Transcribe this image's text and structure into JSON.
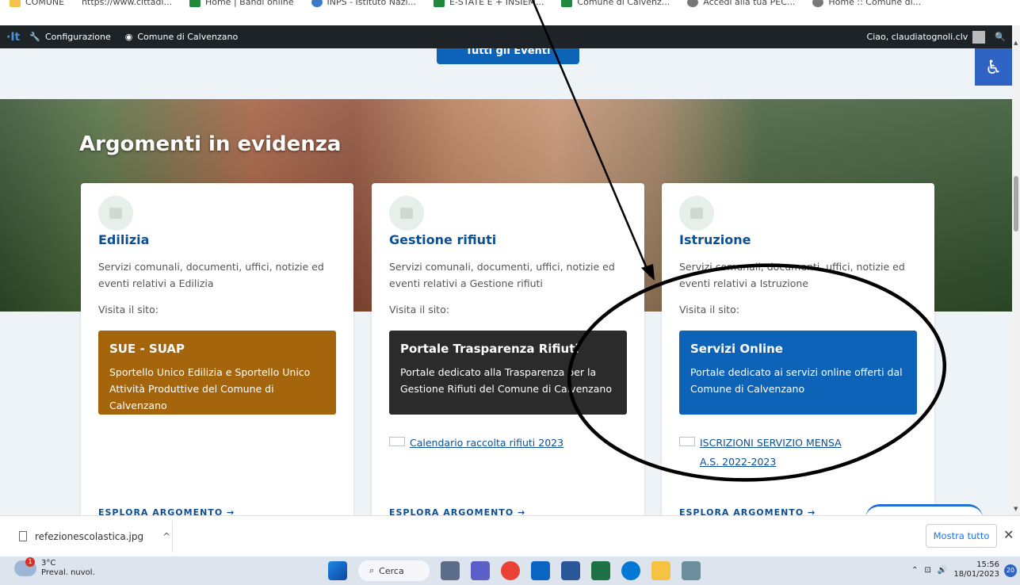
{
  "bookmarks": [
    {
      "label": "COMUNE",
      "icon": "folder-icon"
    },
    {
      "label": "https://www.cittadi...",
      "icon": "web-icon"
    },
    {
      "label": "Home | Bandi online",
      "icon": "bandi-icon"
    },
    {
      "label": "INPS - Istituto Nazi...",
      "icon": "inps-icon"
    },
    {
      "label": "E-STATE E + INSIEM...",
      "icon": "estate-icon"
    },
    {
      "label": "Comune di Calvenz...",
      "icon": "comune-icon"
    },
    {
      "label": "Accedi alla tua PEC...",
      "icon": "pec-icon"
    },
    {
      "label": "Home :: Comune di...",
      "icon": "home-icon"
    }
  ],
  "adminbar": {
    "logo": "·It",
    "config_label": "Configurazione",
    "site_label": "Comune di Calvenzano",
    "greeting": "Ciao, claudiatognoli.clv",
    "search_icon": "🔍"
  },
  "top": {
    "all_events_label": "Tutti gli Eventi"
  },
  "hero": {
    "title": "Argomenti in evidenza"
  },
  "cards": [
    {
      "title": "Edilizia",
      "desc": "Servizi comunali, documenti, uffici, notizie ed eventi relativi a Edilizia",
      "visit": "Visita il sito:",
      "box_title": "SUE - SUAP",
      "box_text": "Sportello Unico Edilizia e Sportello Unico Attività Produttive del Comune di Calvenzano",
      "box_color": "#a5650c",
      "link": "",
      "explore": "ESPLORA ARGOMENTO"
    },
    {
      "title": "Gestione rifiuti",
      "desc": "Servizi comunali, documenti, uffici, notizie ed eventi relativi a Gestione rifiuti",
      "visit": "Visita il sito:",
      "box_title": "Portale Trasparenza Rifiuti",
      "box_text": "Portale dedicato alla Trasparenza per la Gestione Rifiuti del Comune di Calvenzano",
      "box_color": "#2b2b2b",
      "link": "Calendario raccolta rifiuti 2023",
      "explore": "ESPLORA ARGOMENTO"
    },
    {
      "title": "Istruzione",
      "desc": "Servizi comunali, documenti, uffici, notizie ed eventi relativi a Istruzione",
      "visit": "Visita il sito:",
      "box_title": "Servizi Online",
      "box_text": "Portale dedicato ai servizi online offerti dal Comune di Calvenzano",
      "box_color": "#0d63b7",
      "link": "ISCRIZIONI SERVIZIO MENSA A.S. 2022-2023",
      "explore": "ESPLORA ARGOMENTO"
    }
  ],
  "accessibility_icon": "♿",
  "downloads": {
    "file": "refezionescolastica.jpg",
    "chevron": "^",
    "show_all": "Mostra tutto",
    "close": "✕"
  },
  "taskbar": {
    "temp": "3°C",
    "weather": "Preval. nuvol.",
    "weather_badge": "1",
    "search": "Cerca",
    "time": "15:56",
    "date": "18/01/2023",
    "notifications": "20"
  }
}
